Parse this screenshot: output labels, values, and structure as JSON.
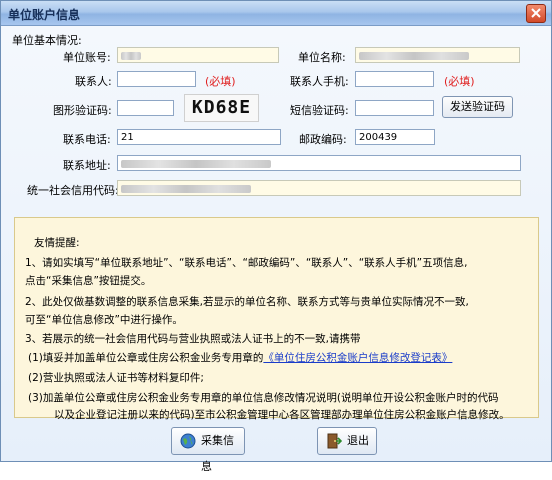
{
  "window": {
    "title": "单位账户信息"
  },
  "section_title": "单位基本情况:",
  "fields": {
    "unit_account": {
      "label": "单位账号:"
    },
    "unit_name": {
      "label": "单位名称:"
    },
    "contact": {
      "label": "联系人:",
      "value": "",
      "required_text": "(必填)"
    },
    "contact_mobile": {
      "label": "联系人手机:",
      "value": "",
      "required_text": "(必填)"
    },
    "captcha": {
      "label": "图形验证码:",
      "value": "",
      "image_text": "KD68E"
    },
    "sms_code": {
      "label": "短信验证码:",
      "value": ""
    },
    "phone": {
      "label": "联系电话:",
      "value": "21"
    },
    "postal_code": {
      "label": "邮政编码:",
      "value": "200439"
    },
    "address": {
      "label": "联系地址:"
    },
    "credit_code": {
      "label": "统一社会信用代码:"
    }
  },
  "buttons": {
    "send_sms": "发送验证码",
    "collect": "采集信息",
    "exit": "退出"
  },
  "notice": {
    "heading": "友情提醒:",
    "lines": [
      "1、请如实填写“单位联系地址”、“联系电话”、“邮政编码”、“联系人”、“联系人手机”五项信息,",
      "点击“采集信息”按钮提交。",
      "2、此处仅做基数调整的联系信息采集,若显示的单位名称、联系方式等与贵单位实际情况不一致,",
      "可至“单位信息修改”中进行操作。",
      "3、若展示的统一社会信用代码与营业执照或法人证书上的不一致,请携带",
      "(1)填妥并加盖单位公章或住房公积金业务专用章的",
      "(2)营业执照或法人证书等材料复印件;",
      "(3)加盖单位公章或住房公积金业务专用章的单位信息修改情况说明(说明单位开设公积金账户时的代码",
      "以及企业登记注册以来的代码)至市公积金管理中心各区管理部办理单位住房公积金账户信息修改。"
    ],
    "link": "《单位住房公积金账户信息修改登记表》"
  },
  "colors": {
    "required": "#e02020",
    "link": "#1a3cc9",
    "notice_bg": "#fdf6dc"
  }
}
